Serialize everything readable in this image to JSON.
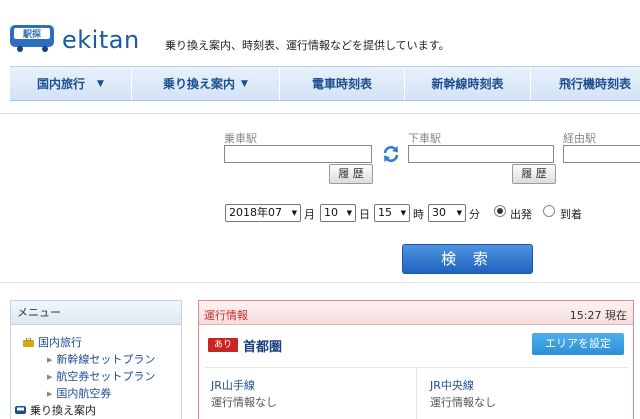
{
  "header": {
    "logo_text": "ekitan",
    "logo_badge": "駅探",
    "tagline": "乗り換え案内、時刻表、運行情報などを提供しています。"
  },
  "nav": {
    "items": [
      {
        "label": "国内旅行",
        "caret": "▼"
      },
      {
        "label": "乗り換え案内",
        "caret": "▼"
      },
      {
        "label": "電車時刻表",
        "caret": ""
      },
      {
        "label": "新幹線時刻表",
        "caret": ""
      },
      {
        "label": "飛行機時刻表",
        "caret": ""
      }
    ]
  },
  "search": {
    "from_label": "乗車駅",
    "to_label": "下車駅",
    "via_label": "経由駅",
    "from_value": "",
    "to_value": "",
    "via_value": "",
    "history_label": "履 歴",
    "year_month": "2018年07",
    "month_unit": "月",
    "day": "10",
    "day_unit": "日",
    "hour": "15",
    "hour_unit": "時",
    "minute": "30",
    "minute_unit": "分",
    "depart_label": "出発",
    "arrive_label": "到着",
    "selected_mode": "depart",
    "submit_label": "検 索"
  },
  "menu": {
    "title": "メニュー",
    "categories": [
      {
        "label": "国内旅行",
        "icon": "suitcase-icon",
        "items": [
          "新幹線セットプラン",
          "航空券セットプラン",
          "国内航空券"
        ]
      },
      {
        "label": "乗り換え案内",
        "icon": "train-icon",
        "items": []
      }
    ]
  },
  "service_info": {
    "title": "運行情報",
    "time": "15:27 現在",
    "badge": "あり",
    "region": "首都圏",
    "area_button": "エリアを設定",
    "lines": [
      {
        "name": "JR山手線",
        "status": "運行情報なし"
      },
      {
        "name": "JR中央線",
        "status": "運行情報なし"
      }
    ]
  },
  "colors": {
    "brand": "#1a5aa0",
    "nav_text": "#1c4d8f",
    "search_button": "#2a6fcc",
    "alert_red": "#c82525",
    "area_button": "#2b8fd6"
  }
}
